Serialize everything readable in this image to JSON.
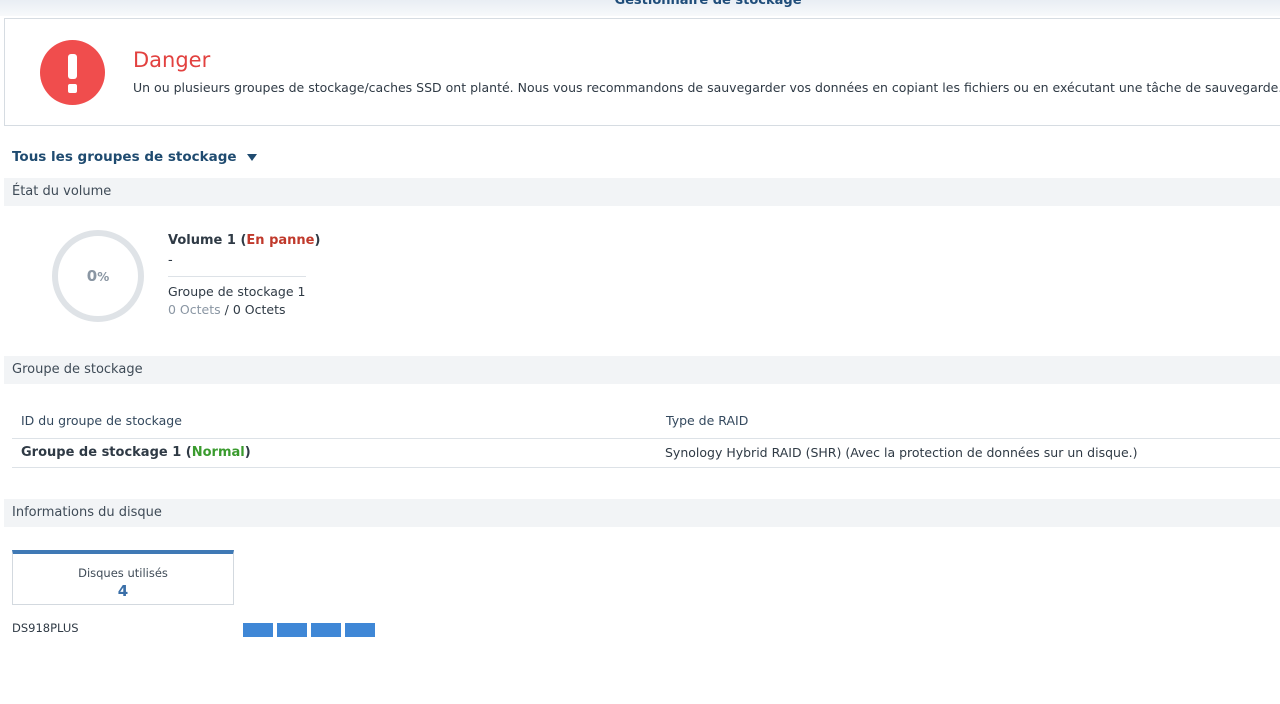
{
  "window": {
    "title": "Gestionnaire de stockage"
  },
  "alert": {
    "title": "Danger",
    "message": "Un ou plusieurs groupes de stockage/caches SSD ont planté. Nous vous recommandons de sauvegarder vos données en copiant les fichiers ou en exécutant une tâche de sauvegarde.",
    "icon": "exclamation-icon",
    "color": "#e2413f"
  },
  "pool_selector": {
    "label": "Tous les groupes de stockage",
    "icon": "caret-down-icon"
  },
  "volume_section": {
    "heading": "État du volume",
    "usage_percent": "0",
    "usage_unit": "%",
    "name": "Volume 1",
    "status": "En panne",
    "status_color": "#c0392b",
    "description": "-",
    "pool": "Groupe de stockage 1",
    "used": "0 Octets",
    "separator": "/",
    "total": "0 Octets"
  },
  "pool_section": {
    "heading": "Groupe de stockage",
    "columns": [
      "ID du groupe de stockage",
      "Type de RAID"
    ],
    "rows": [
      {
        "id": "Groupe de stockage 1",
        "status": "Normal",
        "raid": "Synology Hybrid RAID (SHR) (Avec la protection de données sur un disque.)"
      }
    ],
    "status_color": "#3a9b2e"
  },
  "disk_section": {
    "heading": "Informations du disque",
    "used_label": "Disques utilisés",
    "used_count": "4",
    "model": "DS918PLUS",
    "slot_color": "#3f87d6"
  }
}
